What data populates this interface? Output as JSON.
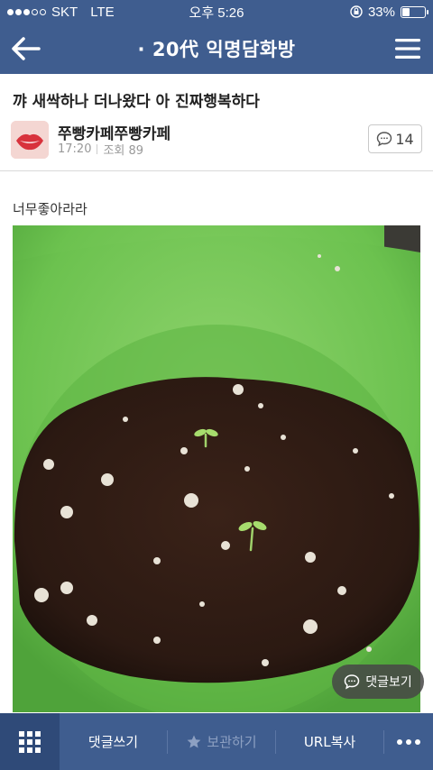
{
  "status_bar": {
    "carrier": "SKT",
    "network": "LTE",
    "time": "오후 5:26",
    "battery": "33%",
    "battery_level": 0.33
  },
  "nav": {
    "title": "· 20代 익명담화방"
  },
  "post": {
    "title": "꺄 새싹하나 더나왔다 아 진짜행복하다",
    "author": "쭈빵카페쭈빵카페",
    "time": "17:20",
    "views": "조회 89",
    "comment_count": "14",
    "body": "너무좋아라라"
  },
  "floating": {
    "view_comments": "댓글보기"
  },
  "bottom_bar": {
    "write_comment": "댓글쓰기",
    "bookmark": "보관하기",
    "copy_url": "URL복사"
  },
  "colors": {
    "header": "#3f5d8f",
    "bottom_grid": "#2f4a78"
  },
  "icons": [
    "back-arrow-icon",
    "hamburger-menu-icon",
    "speech-bubble-icon",
    "grid-icon",
    "star-icon",
    "more-dots-icon"
  ]
}
